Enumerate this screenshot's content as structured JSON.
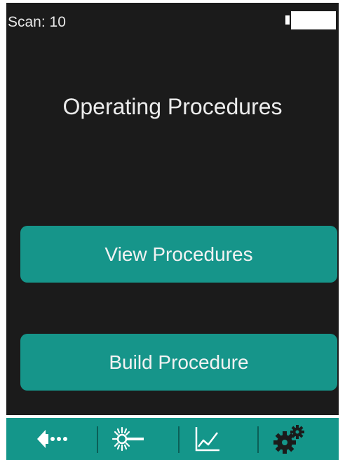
{
  "status": {
    "scan_label": "Scan: 10",
    "battery_icon": "battery-icon"
  },
  "page": {
    "title": "Operating Procedures"
  },
  "actions": {
    "view_label": "View Procedures",
    "build_label": "Build Procedure"
  },
  "navbar": {
    "items": [
      {
        "icon": "back-arrow-icon"
      },
      {
        "icon": "laser-scan-icon"
      },
      {
        "icon": "line-chart-icon"
      },
      {
        "icon": "settings-gears-icon"
      }
    ]
  },
  "colors": {
    "background": "#1b1b1b",
    "accent": "#16958a",
    "text": "#ececec"
  }
}
